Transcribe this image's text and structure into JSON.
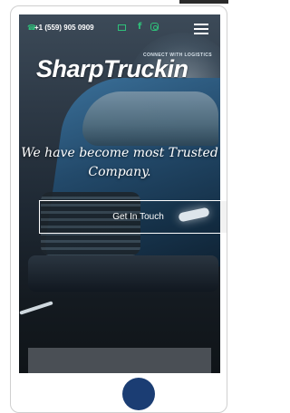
{
  "topbar": {
    "phone": "+1 (559) 905 0909"
  },
  "brand": {
    "logo_text": "SharpTruckin",
    "tagline": "CONNECT WITH LOGISTICS"
  },
  "hero": {
    "headline": "We have become most Trusted Company.",
    "cta_label": "Get In Touch"
  },
  "colors": {
    "accent": "#2fc07a",
    "dot": "#1b3d73"
  }
}
